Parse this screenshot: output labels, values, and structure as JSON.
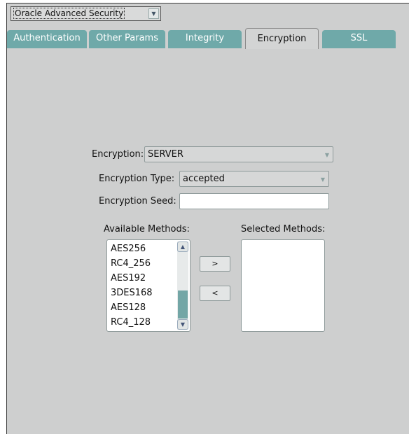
{
  "header": {
    "module_select": "Oracle Advanced Security"
  },
  "tabs": [
    {
      "label": "Authentication"
    },
    {
      "label": "Other Params"
    },
    {
      "label": "Integrity"
    },
    {
      "label": "Encryption"
    },
    {
      "label": "SSL"
    }
  ],
  "active_tab": "Encryption",
  "form": {
    "encryption_label": "Encryption:",
    "encryption_value": "SERVER",
    "type_label": "Encryption Type:",
    "type_value": "accepted",
    "seed_label": "Encryption Seed:",
    "seed_value": ""
  },
  "methods": {
    "available_label": "Available Methods:",
    "selected_label": "Selected Methods:",
    "available": [
      "AES256",
      "RC4_256",
      "AES192",
      "3DES168",
      "AES128",
      "RC4_128"
    ],
    "selected": [],
    "add_button": ">",
    "remove_button": "<"
  },
  "icons": {
    "dropdown": "chevron-down-icon",
    "scroll_up": "arrow-up-icon",
    "scroll_down": "arrow-down-icon"
  }
}
